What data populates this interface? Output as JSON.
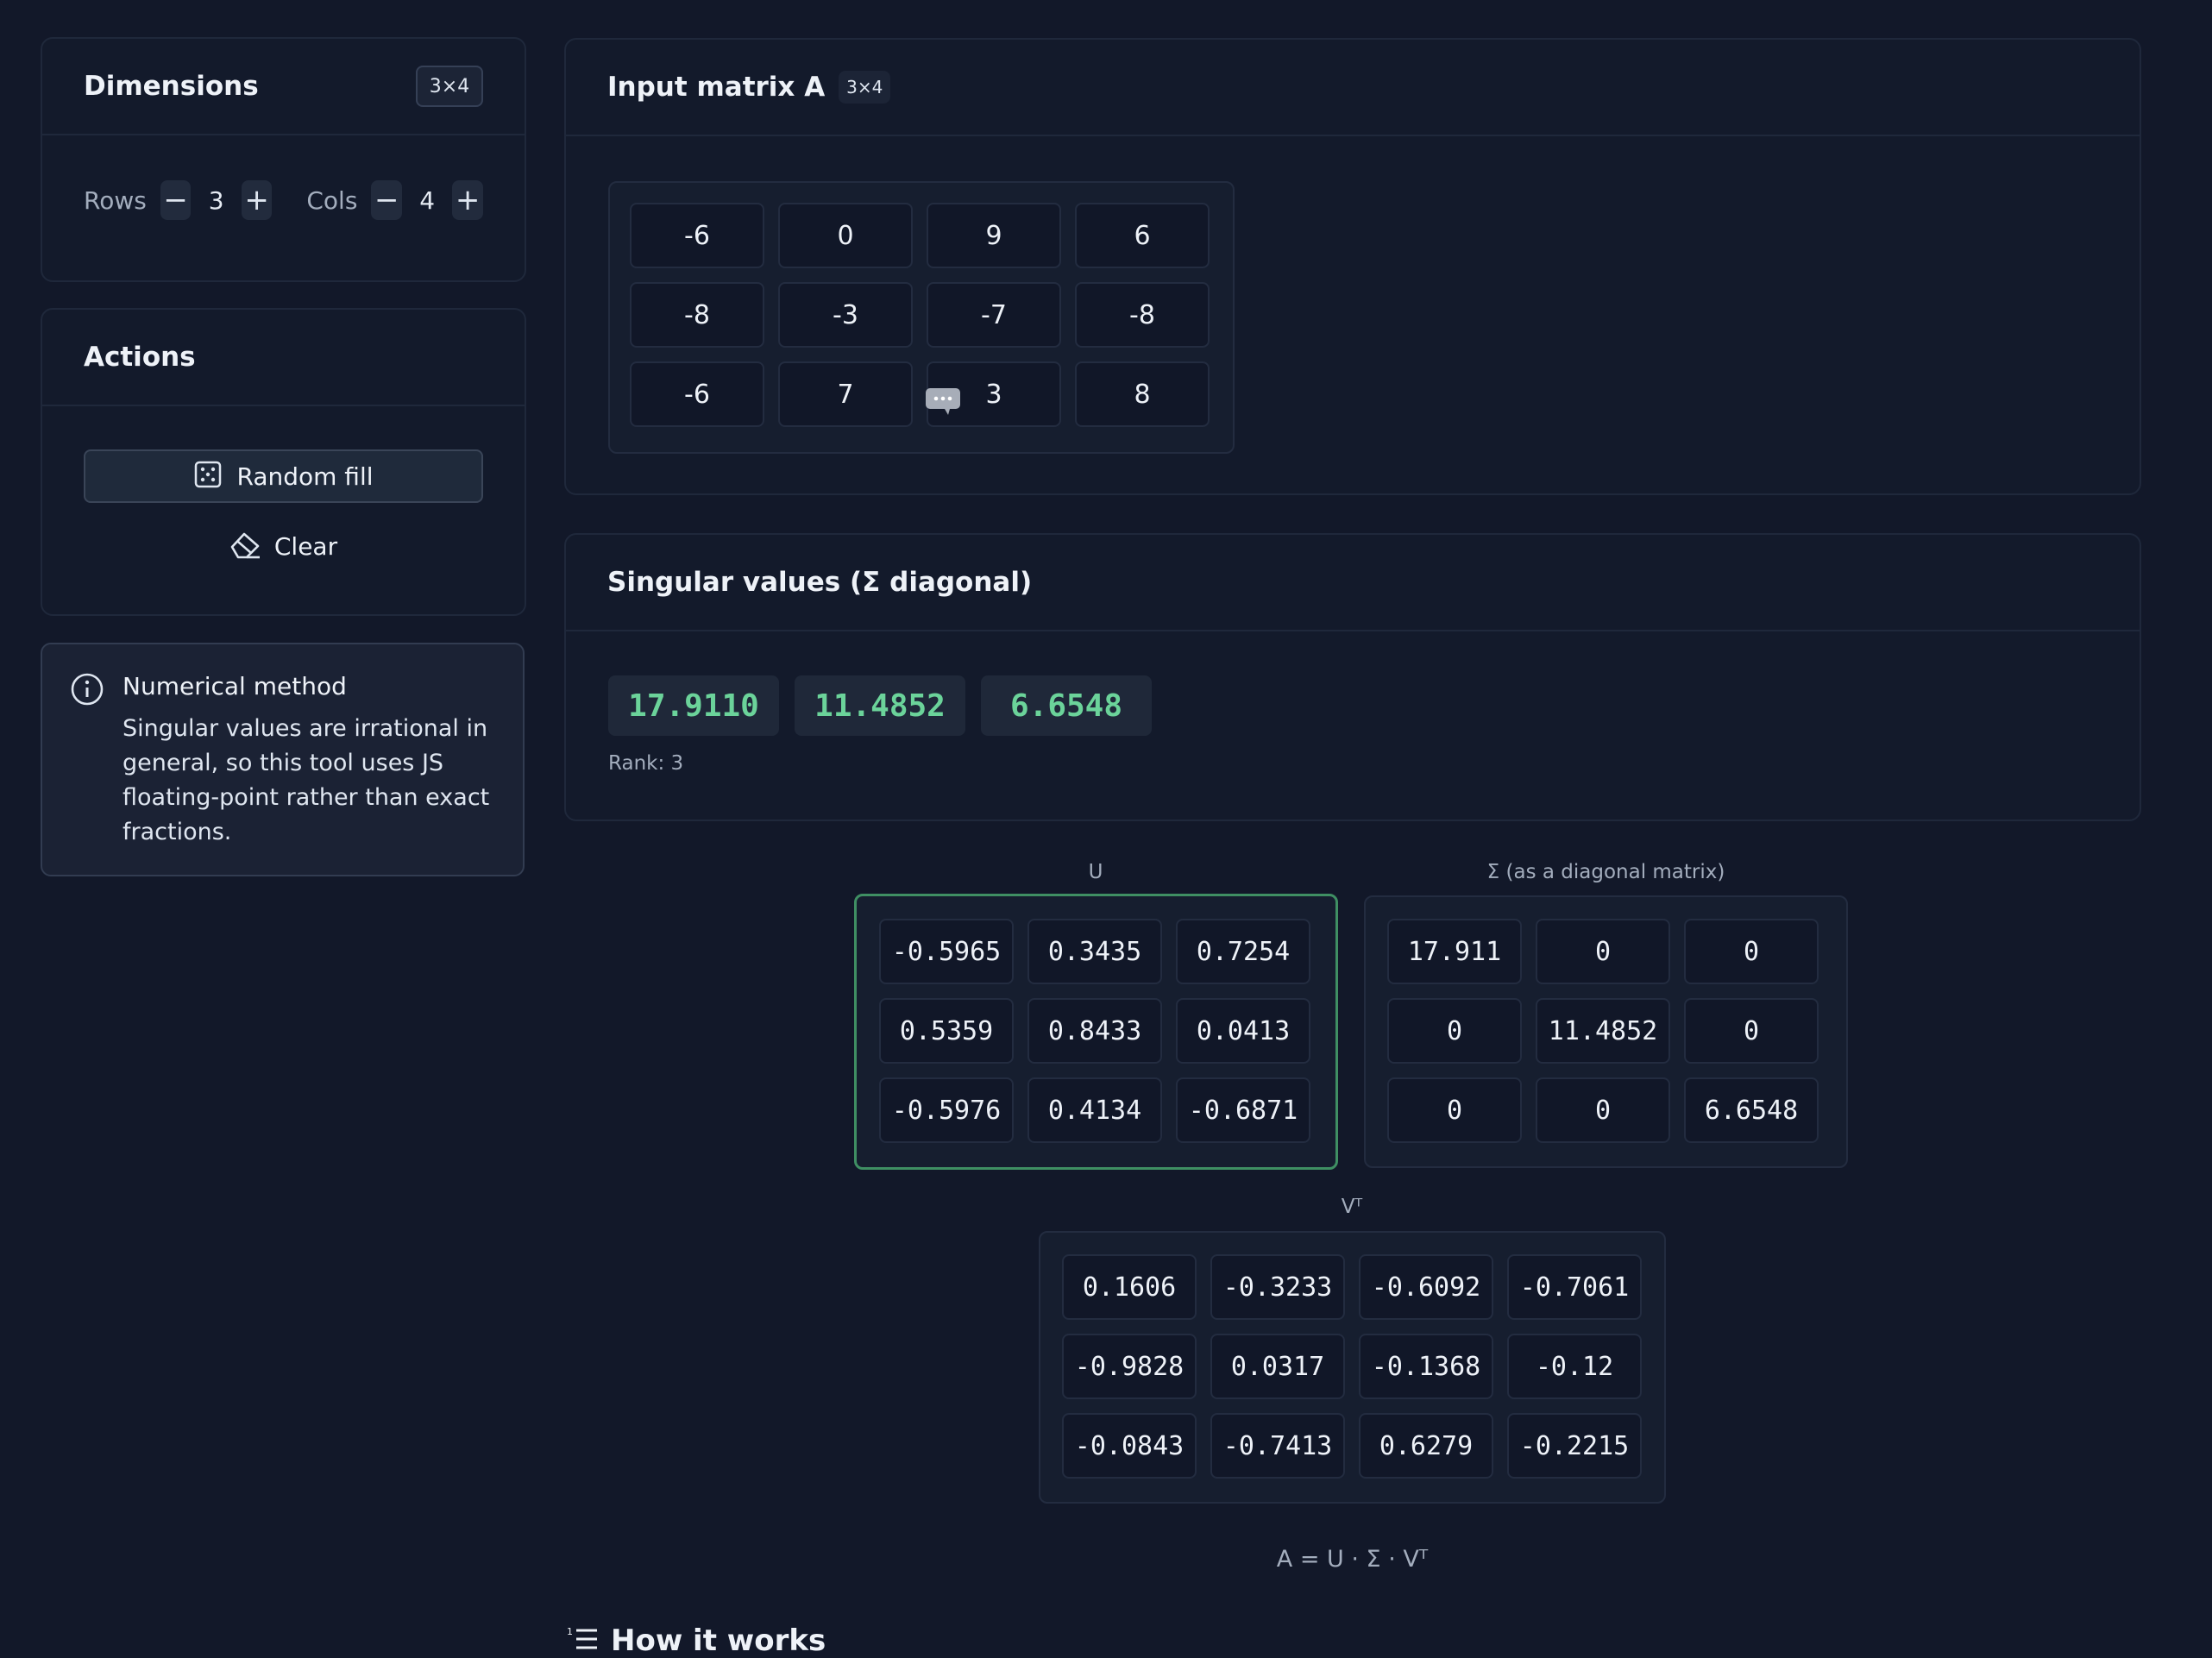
{
  "dimensions": {
    "title": "Dimensions",
    "badge": "3×4",
    "rows_label": "Rows",
    "rows_value": "3",
    "cols_label": "Cols",
    "cols_value": "4",
    "minus": "−",
    "plus": "+"
  },
  "actions": {
    "title": "Actions",
    "random_fill": "Random fill",
    "clear": "Clear"
  },
  "info": {
    "title": "Numerical method",
    "text": "Singular values are irrational in general, so this tool uses JS floating-point rather than exact fractions.",
    "icon": "info-icon"
  },
  "input_matrix": {
    "title": "Input matrix A",
    "badge": "3×4",
    "rows": [
      [
        "-6",
        "0",
        "9",
        "6"
      ],
      [
        "-8",
        "-3",
        "-7",
        "-8"
      ],
      [
        "-6",
        "7",
        "3",
        "8"
      ]
    ]
  },
  "singular_values": {
    "title": "Singular values (Σ diagonal)",
    "values": [
      "17.9110",
      "11.4852",
      "6.6548"
    ],
    "rank": "Rank: 3"
  },
  "u_matrix": {
    "label": "U",
    "rows": [
      [
        "-0.5965",
        "0.3435",
        "0.7254"
      ],
      [
        "0.5359",
        "0.8433",
        "0.0413"
      ],
      [
        "-0.5976",
        "0.4134",
        "-0.6871"
      ]
    ]
  },
  "sigma_matrix": {
    "label": "Σ (as a diagonal matrix)",
    "rows": [
      [
        "17.911",
        "0",
        "0"
      ],
      [
        "0",
        "11.4852",
        "0"
      ],
      [
        "0",
        "0",
        "6.6548"
      ]
    ]
  },
  "vt_matrix": {
    "label": "Vᵀ",
    "rows": [
      [
        "0.1606",
        "-0.3233",
        "-0.6092",
        "-0.7061"
      ],
      [
        "-0.9828",
        "0.0317",
        "-0.1368",
        "-0.12"
      ],
      [
        "-0.0843",
        "-0.7413",
        "0.6279",
        "-0.2215"
      ]
    ]
  },
  "formula": "A = U · Σ · Vᵀ",
  "how_it_works": "How it works",
  "colors": {
    "accent_green": "#6bd39a",
    "highlight_border": "#3f8f63",
    "background": "#121829"
  }
}
